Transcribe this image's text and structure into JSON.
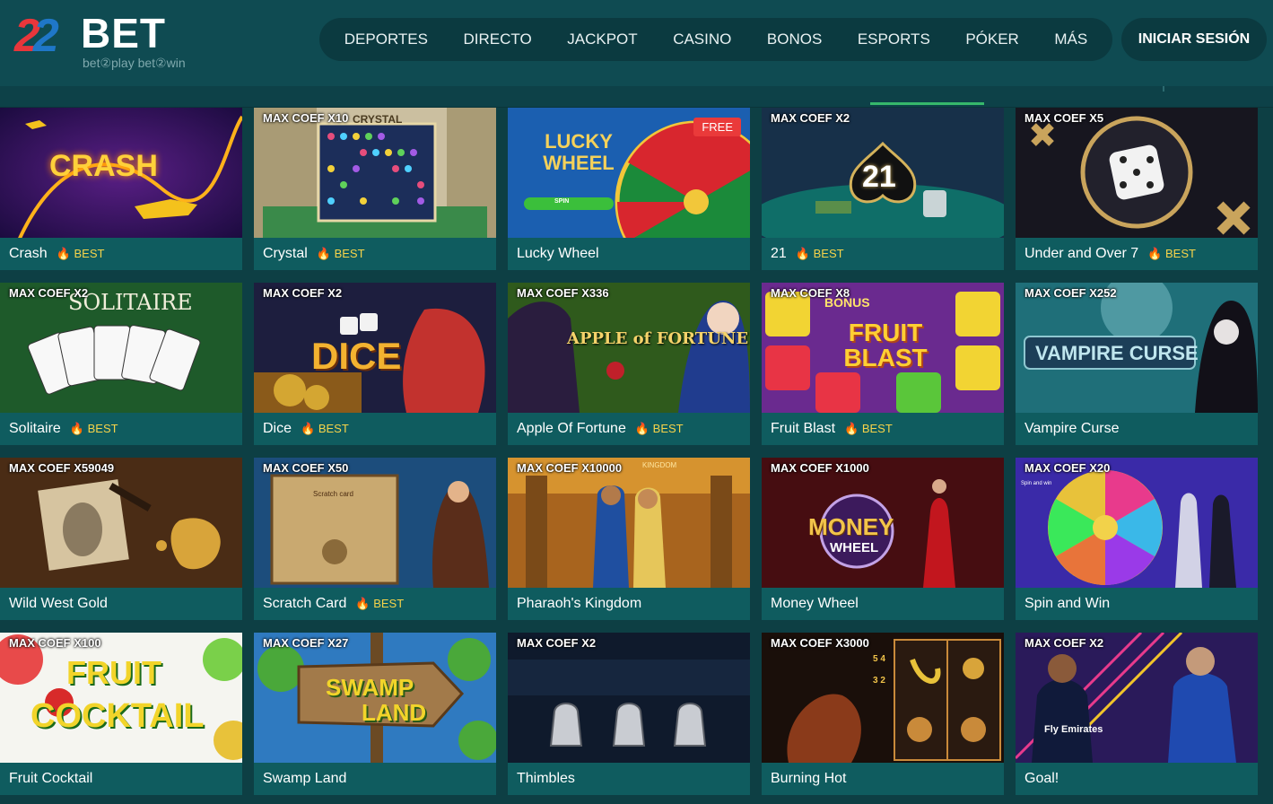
{
  "brand": {
    "logo_number": "22",
    "logo_word": "BET",
    "tagline": "bet②play bet②win",
    "colors": {
      "red": "#e8363b",
      "blue": "#1f77c8",
      "accent_green": "#36b86b",
      "best": "#f6d34a"
    }
  },
  "nav": {
    "items": [
      {
        "label": "DEPORTES"
      },
      {
        "label": "DIRECTO"
      },
      {
        "label": "JACKPOT"
      },
      {
        "label": "CASINO"
      },
      {
        "label": "BONOS"
      },
      {
        "label": "ESPORTS"
      },
      {
        "label": "PÓKER"
      },
      {
        "label": "MÁS"
      }
    ],
    "login_label": "INICIAR SESIÓN"
  },
  "games": [
    {
      "name": "Crash",
      "best": "BEST",
      "coef": "",
      "art": "CRASH"
    },
    {
      "name": "Crystal",
      "best": "BEST",
      "coef": "MAX COEF X10",
      "art": "CRYSTAL"
    },
    {
      "name": "Lucky Wheel",
      "best": "",
      "coef": "",
      "badge": "FREE",
      "art": "LUCKY WHEEL",
      "art_extra": "SPIN"
    },
    {
      "name": "21",
      "best": "BEST",
      "coef": "MAX COEF X2",
      "art": "21"
    },
    {
      "name": "Under and Over 7",
      "best": "BEST",
      "coef": "MAX COEF X5",
      "art": ""
    },
    {
      "name": "Solitaire",
      "best": "BEST",
      "coef": "MAX COEF X2",
      "art": "SOLITAIRE"
    },
    {
      "name": "Dice",
      "best": "BEST",
      "coef": "MAX COEF X2",
      "art": "DICE"
    },
    {
      "name": "Apple Of Fortune",
      "best": "BEST",
      "coef": "MAX COEF X336",
      "art": "APPLE of FORTUNE"
    },
    {
      "name": "Fruit Blast",
      "best": "BEST",
      "coef": "MAX COEF X8",
      "art": "FRUIT BLAST",
      "art_extra": "BONUS"
    },
    {
      "name": "Vampire Curse",
      "best": "",
      "coef": "MAX COEF X252",
      "art": "VAMPIRE CURSE"
    },
    {
      "name": "Wild West Gold",
      "best": "",
      "coef": "MAX COEF X59049",
      "art": ""
    },
    {
      "name": "Scratch Card",
      "best": "BEST",
      "coef": "MAX COEF X50",
      "art": "Scratch card"
    },
    {
      "name": "Pharaoh's Kingdom",
      "best": "",
      "coef": "MAX COEF X10000",
      "art": "KINGDOM"
    },
    {
      "name": "Money Wheel",
      "best": "",
      "coef": "MAX COEF X1000",
      "art": "MONEY",
      "art_extra": "WHEEL"
    },
    {
      "name": "Spin and Win",
      "best": "",
      "coef": "MAX COEF X20",
      "art": "Spin and win"
    },
    {
      "name": "Fruit Cocktail",
      "best": "",
      "coef": "MAX COEF X100",
      "art": "FRUIT",
      "art_extra": "COCKTAIL"
    },
    {
      "name": "Swamp Land",
      "best": "",
      "coef": "MAX COEF X27",
      "art": "SWAMP",
      "art_extra": "LAND"
    },
    {
      "name": "Thimbles",
      "best": "",
      "coef": "MAX COEF X2",
      "art": ""
    },
    {
      "name": "Burning Hot",
      "best": "",
      "coef": "MAX COEF X3000",
      "art": "5 4 3 2"
    },
    {
      "name": "Goal!",
      "best": "",
      "coef": "MAX COEF X2",
      "art": "Fly Emirates"
    }
  ]
}
